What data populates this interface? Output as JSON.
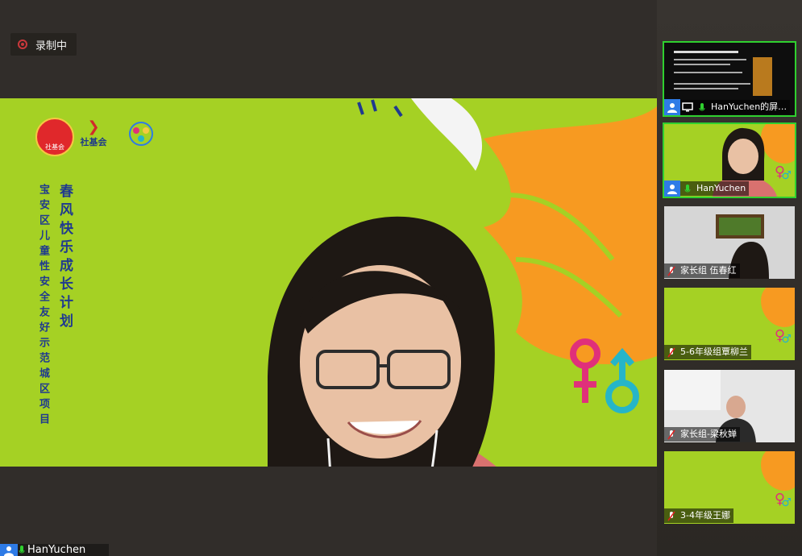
{
  "recording": {
    "label": "录制中"
  },
  "main_video": {
    "name": "HanYuchen",
    "banner": {
      "logo1": "社基会",
      "logo2": "社基会",
      "title": "春风快乐成长计划",
      "subtitle": "宝安区儿童性安全友好示范城区项目"
    }
  },
  "participants": [
    {
      "name": "HanYuchen的屏…",
      "kind": "screen-share"
    },
    {
      "name": "HanYuchen",
      "kind": "video"
    },
    {
      "name": "家长组 伍春红",
      "kind": "video"
    },
    {
      "name": "5-6年级组覃柳兰",
      "kind": "slide"
    },
    {
      "name": "家长组-梁秋婵",
      "kind": "video"
    },
    {
      "name": "3-4年级王娜",
      "kind": "slide"
    }
  ],
  "colors": {
    "slide_green": "#a5d124",
    "accent_blue": "#2e7be6",
    "active_green": "#2fd02f",
    "record_red": "#c9383b"
  }
}
